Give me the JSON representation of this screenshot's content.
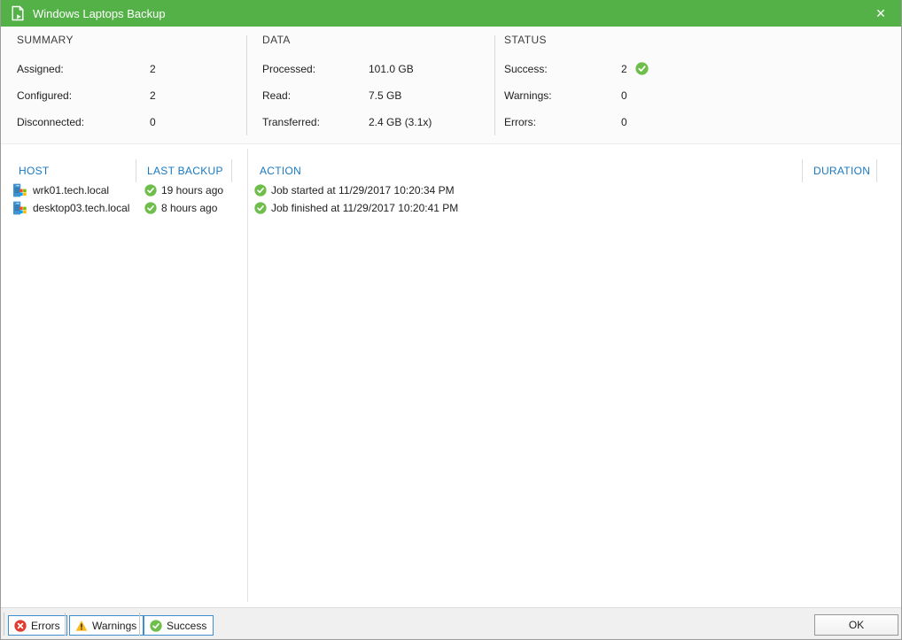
{
  "window": {
    "title": "Windows Laptops Backup",
    "close_glyph": "✕"
  },
  "colors": {
    "titlebar_green": "#54b148",
    "header_blue": "#1879c2",
    "success_green": "#6fbe4b",
    "error_red": "#e03c31",
    "warning_yellow": "#fdb913"
  },
  "summary": {
    "header": "SUMMARY",
    "rows": [
      {
        "label": "Assigned:",
        "value": "2"
      },
      {
        "label": "Configured:",
        "value": "2"
      },
      {
        "label": "Disconnected:",
        "value": "0"
      }
    ]
  },
  "data": {
    "header": "DATA",
    "rows": [
      {
        "label": "Processed:",
        "value": "101.0 GB"
      },
      {
        "label": "Read:",
        "value": "7.5 GB"
      },
      {
        "label": "Transferred:",
        "value": "2.4 GB (3.1x)"
      }
    ]
  },
  "status": {
    "header": "STATUS",
    "rows": [
      {
        "label": "Success:",
        "value": "2",
        "icon": "success-icon"
      },
      {
        "label": "Warnings:",
        "value": "0"
      },
      {
        "label": "Errors:",
        "value": "0"
      }
    ]
  },
  "hosts": {
    "host_header": "HOST",
    "last_backup_header": "LAST BACKUP",
    "rows": [
      {
        "name": "wrk01.tech.local",
        "last_backup": "19 hours ago",
        "status": "success"
      },
      {
        "name": "desktop03.tech.local",
        "last_backup": "8 hours ago",
        "status": "success"
      }
    ]
  },
  "actions": {
    "action_header": "ACTION",
    "duration_header": "DURATION",
    "rows": [
      {
        "text": "Job started at 11/29/2017 10:20:34 PM",
        "status": "success",
        "duration": ""
      },
      {
        "text": "Job finished at 11/29/2017 10:20:41 PM",
        "status": "success",
        "duration": ""
      }
    ]
  },
  "footer": {
    "filters": [
      {
        "label": "Errors",
        "icon": "error-icon"
      },
      {
        "label": "Warnings",
        "icon": "warning-icon"
      },
      {
        "label": "Success",
        "icon": "success-icon"
      }
    ],
    "ok_label": "OK"
  }
}
